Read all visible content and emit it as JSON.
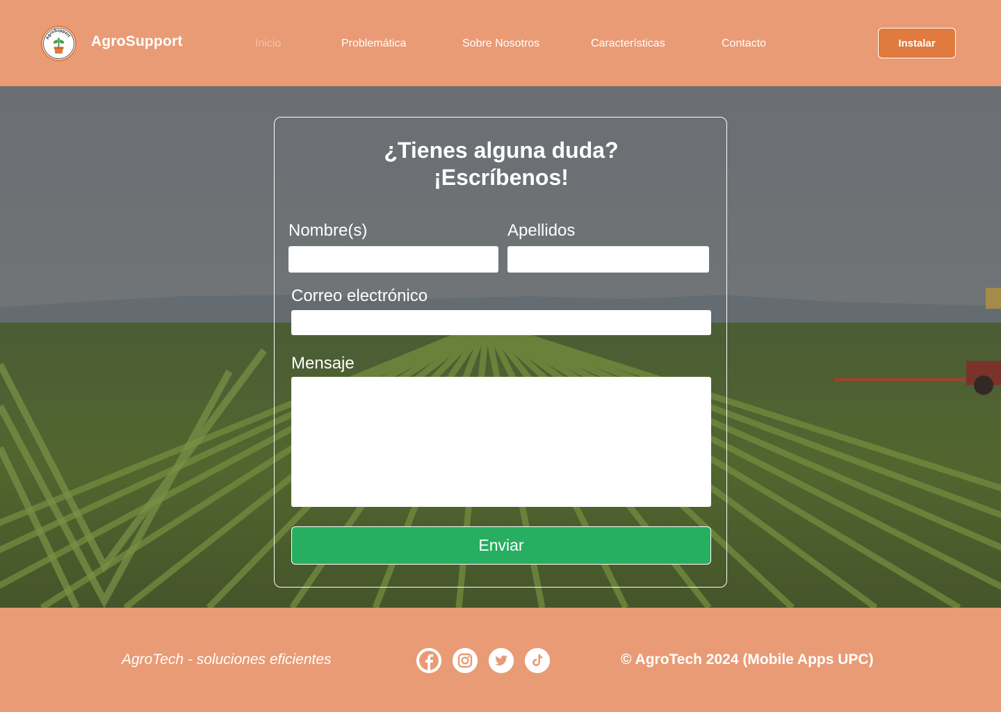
{
  "header": {
    "brand": "AgroSupport",
    "logo_text": "AgroSupport",
    "nav": [
      {
        "label": "Inicio",
        "active": true
      },
      {
        "label": "Problemática"
      },
      {
        "label": "Sobre Nosotros"
      },
      {
        "label": "Características"
      },
      {
        "label": "Contacto"
      }
    ],
    "install_label": "Instalar"
  },
  "form": {
    "title_line1": "¿Tienes alguna duda?",
    "title_line2": "¡Escríbenos!",
    "first_name_label": "Nombre(s)",
    "first_name_value": "",
    "last_name_label": "Apellidos",
    "last_name_value": "",
    "email_label": "Correo electrónico",
    "email_value": "",
    "message_label": "Mensaje",
    "message_value": "",
    "submit_label": "Enviar"
  },
  "footer": {
    "tagline": "AgroTech - soluciones eficientes",
    "social": [
      "facebook-icon",
      "instagram-icon",
      "twitter-icon",
      "tiktok-icon"
    ],
    "copyright": "© AgroTech 2024 (Mobile Apps UPC)"
  },
  "colors": {
    "header_bg": "#E99B75",
    "accent": "#E07A3E",
    "submit": "#27AE60",
    "nav_active": "#F3C2A8"
  }
}
